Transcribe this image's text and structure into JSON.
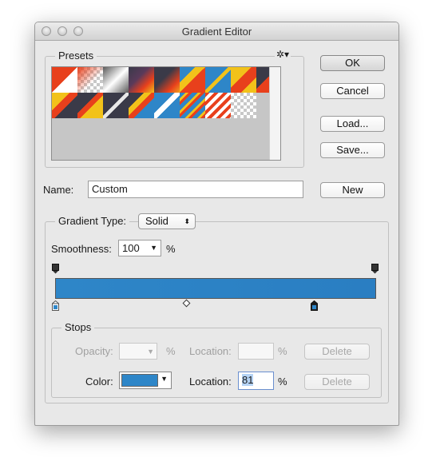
{
  "window": {
    "title": "Gradient Editor"
  },
  "presets": {
    "label": "Presets",
    "menu_icon": "gear-icon"
  },
  "buttons": {
    "ok": "OK",
    "cancel": "Cancel",
    "load": "Load...",
    "save": "Save...",
    "new": "New",
    "delete_opacity": "Delete",
    "delete_color": "Delete"
  },
  "name": {
    "label": "Name:",
    "value": "Custom"
  },
  "gradient_type": {
    "label": "Gradient Type:",
    "value": "Solid"
  },
  "smoothness": {
    "label": "Smoothness:",
    "value": "100",
    "unit": "%"
  },
  "gradient": {
    "color_start": "#2e86c8",
    "color_end": "#2a7ec2",
    "midpoint": 0.5
  },
  "stops": {
    "label": "Stops",
    "opacity_label": "Opacity:",
    "opacity_value": "",
    "opacity_unit": "%",
    "opacity_location_label": "Location:",
    "opacity_location_value": "",
    "opacity_location_unit": "%",
    "color_label": "Color:",
    "color_value": "#2e86c8",
    "color_location_label": "Location:",
    "color_location_value": "81",
    "color_location_unit": "%"
  },
  "opacity_stops": [
    {
      "location": 0
    },
    {
      "location": 100
    }
  ],
  "color_stops": [
    {
      "location": 0,
      "selected": false
    },
    {
      "location": 81,
      "selected": true
    }
  ]
}
